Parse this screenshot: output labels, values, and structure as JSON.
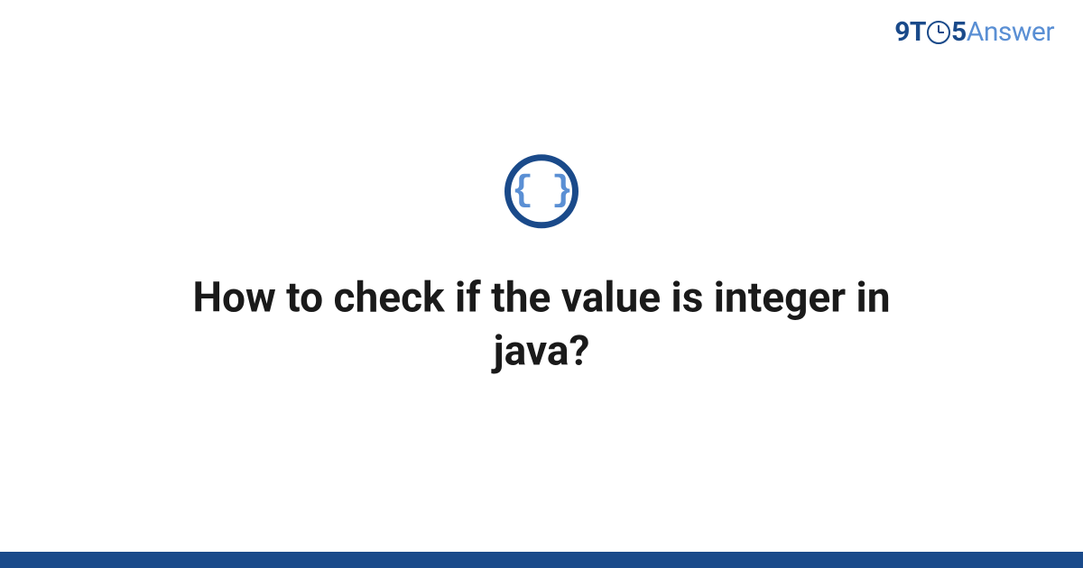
{
  "logo": {
    "part1": "9T",
    "part2": "5",
    "part3": "Answer"
  },
  "icon": {
    "braces": "{ }"
  },
  "title": "How to check if the value is integer in java?"
}
